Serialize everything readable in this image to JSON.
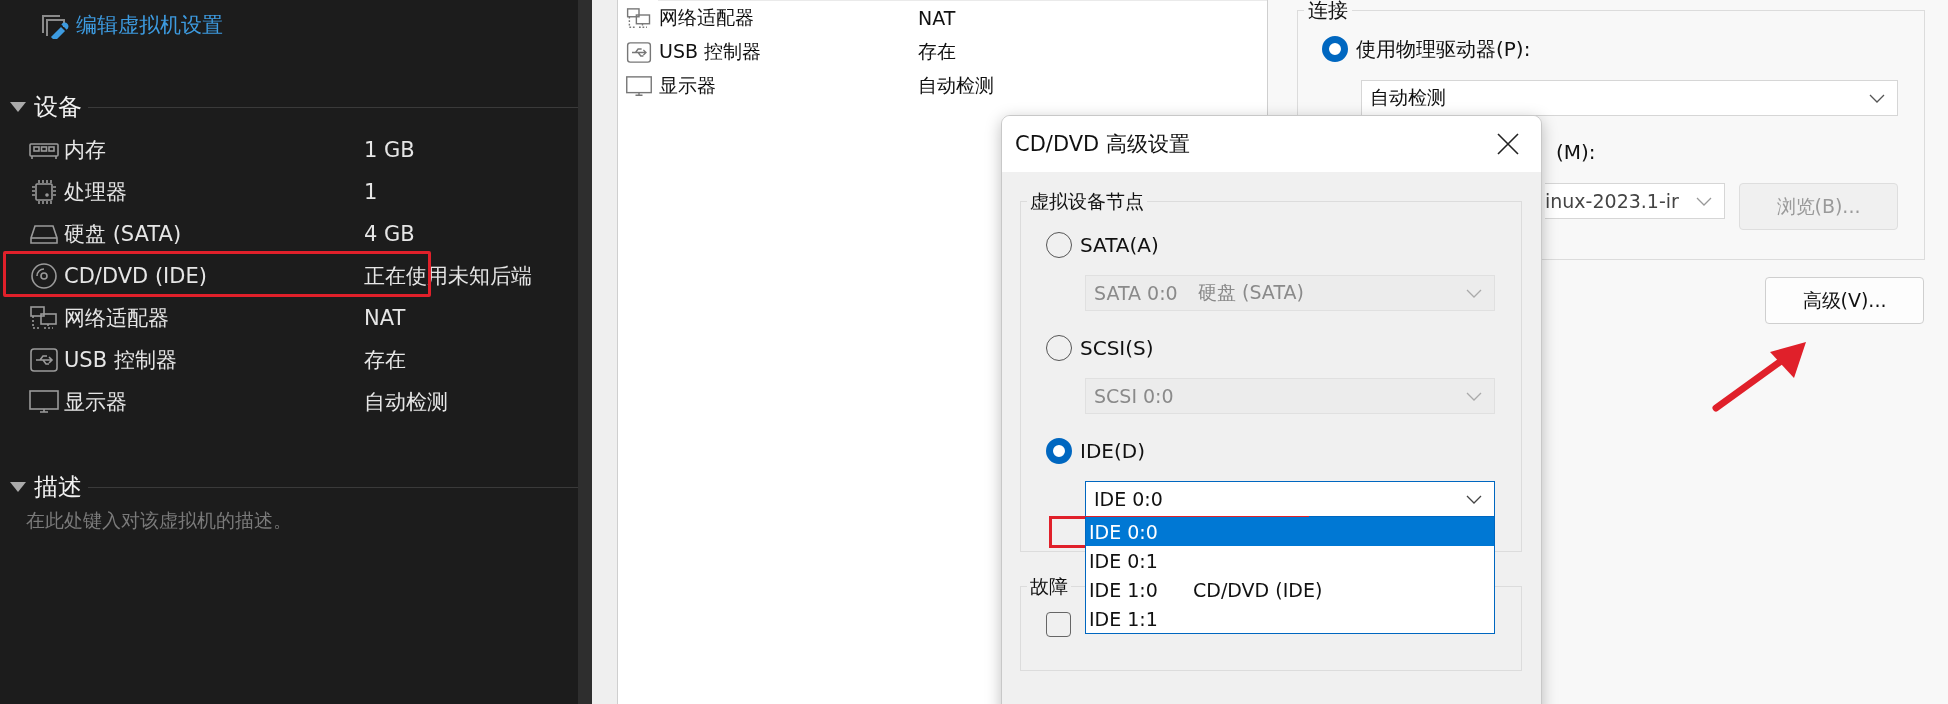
{
  "sidebar": {
    "edit_link": "编辑虚拟机设置",
    "devices_section": {
      "title": "设备",
      "expanded": true,
      "devices": [
        {
          "kind": "memory",
          "name": "内存",
          "value": "1 GB",
          "highlighted": false
        },
        {
          "kind": "cpu",
          "name": "处理器",
          "value": "1",
          "highlighted": false
        },
        {
          "kind": "disk",
          "name": "硬盘 (SATA)",
          "value": "4 GB",
          "highlighted": false
        },
        {
          "kind": "cd",
          "name": "CD/DVD (IDE)",
          "value": "正在使用未知后端",
          "highlighted": true
        },
        {
          "kind": "network",
          "name": "网络适配器",
          "value": "NAT",
          "highlighted": false
        },
        {
          "kind": "usb",
          "name": "USB 控制器",
          "value": "存在",
          "highlighted": false
        },
        {
          "kind": "display",
          "name": "显示器",
          "value": "自动检测",
          "highlighted": false
        }
      ]
    },
    "description_section": {
      "title": "描述",
      "expanded": true,
      "placeholder": "在此处键入对该虚拟机的描述。"
    }
  },
  "device_list": {
    "rows": [
      {
        "kind": "network",
        "name": "网络适配器",
        "value": "NAT"
      },
      {
        "kind": "usb",
        "name": "USB 控制器",
        "value": "存在"
      },
      {
        "kind": "display",
        "name": "显示器",
        "value": "自动检测"
      }
    ]
  },
  "connection": {
    "title": "连接",
    "physical_drive": {
      "label": "使用物理驱动器(P):",
      "selected": true
    },
    "drive_select": "自动检测",
    "file_label": "(M):",
    "file_select": "inux-2023.1-ir",
    "browse_button": {
      "label": "浏览(B)...",
      "disabled": true
    }
  },
  "advanced_button": "高级(V)...",
  "dialog": {
    "title": "CD/DVD 高级设置",
    "node_group": {
      "title": "虚拟设备节点",
      "buses": [
        {
          "label": "SATA(A)",
          "selected": false,
          "select": {
            "slot": "SATA 0:0",
            "device": "硬盘 (SATA)",
            "disabled": true,
            "open": false
          }
        },
        {
          "label": "SCSI(S)",
          "selected": false,
          "select": {
            "slot": "SCSI 0:0",
            "disabled": true,
            "open": false
          }
        },
        {
          "label": "IDE(D)",
          "selected": true,
          "select": {
            "slot": "IDE 0:0",
            "disabled": false,
            "open": true,
            "options": [
              {
                "slot": "IDE 0:0",
                "selected": true,
                "highlighted": true
              },
              {
                "slot": "IDE 0:1",
                "selected": false,
                "highlighted": false
              },
              {
                "slot": "IDE 1:0",
                "device": "CD/DVD (IDE)",
                "selected": false,
                "highlighted": false
              },
              {
                "slot": "IDE 1:1",
                "selected": false,
                "highlighted": false
              }
            ]
          }
        }
      ]
    },
    "fault_group": {
      "title": "故障",
      "checked": false
    }
  }
}
